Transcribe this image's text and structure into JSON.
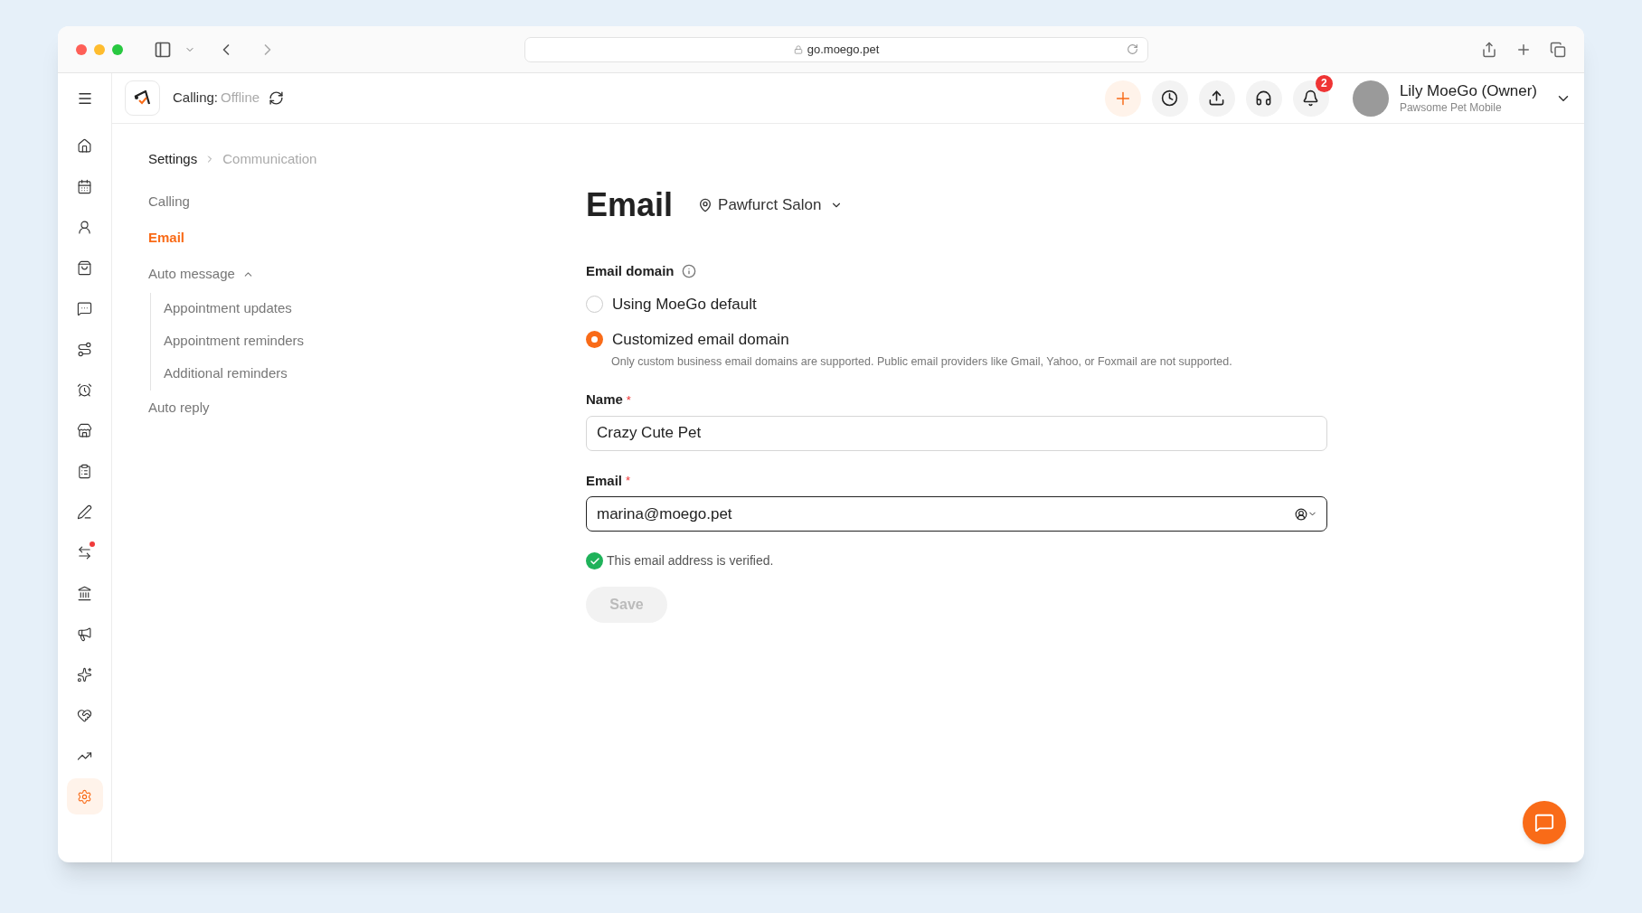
{
  "browser": {
    "address": "go.moego.pet"
  },
  "header": {
    "calling_label": "Calling:",
    "calling_status": "Offline",
    "notification_count": "2",
    "user_name": "Lily MoeGo (Owner)",
    "business": "Pawsome Pet Mobile"
  },
  "sidebar": {
    "items": [
      {
        "selected": false,
        "dot": false
      },
      {
        "selected": false,
        "dot": false
      },
      {
        "selected": false,
        "dot": false
      },
      {
        "selected": false,
        "dot": false
      },
      {
        "selected": false,
        "dot": false
      },
      {
        "selected": false,
        "dot": false
      },
      {
        "selected": false,
        "dot": false
      },
      {
        "selected": false,
        "dot": false
      },
      {
        "selected": false,
        "dot": false
      },
      {
        "selected": false,
        "dot": false
      },
      {
        "selected": false,
        "dot": true
      },
      {
        "selected": false,
        "dot": false
      },
      {
        "selected": false,
        "dot": false
      },
      {
        "selected": false,
        "dot": false
      },
      {
        "selected": false,
        "dot": false
      },
      {
        "selected": false,
        "dot": false
      },
      {
        "selected": true,
        "dot": false
      }
    ]
  },
  "breadcrumb": [
    "Settings",
    "Communication"
  ],
  "settings_nav": [
    {
      "label": "Calling",
      "selected": false
    },
    {
      "label": "Email",
      "selected": true
    },
    {
      "label": "Auto message",
      "selected": false,
      "expanded": true,
      "children": [
        {
          "label": "Appointment updates",
          "selected": false
        },
        {
          "label": "Appointment reminders",
          "selected": false
        },
        {
          "label": "Additional reminders",
          "selected": false
        }
      ]
    },
    {
      "label": "Auto reply",
      "selected": false
    }
  ],
  "page": {
    "title": "Email",
    "location": "Pawfurct Salon"
  },
  "email_domain": {
    "label": "Email domain",
    "options": [
      {
        "label": "Using MoeGo default",
        "selected": false
      },
      {
        "label": "Customized email domain",
        "selected": true,
        "hint": "Only custom business email domains are supported. Public email providers like Gmail, Yahoo, or Foxmail are not supported."
      }
    ]
  },
  "fields": [
    {
      "label": "Name",
      "required_mark": "*",
      "value": "Crazy Cute Pet",
      "focused": false,
      "kind": "text"
    },
    {
      "label": "Email",
      "required_mark": "*",
      "value": "marina@moego.pet",
      "focused": true,
      "kind": "select"
    }
  ],
  "verification": {
    "verified": true,
    "text": "This email address is verified."
  },
  "save_button": {
    "label": "Save",
    "disabled": true
  }
}
